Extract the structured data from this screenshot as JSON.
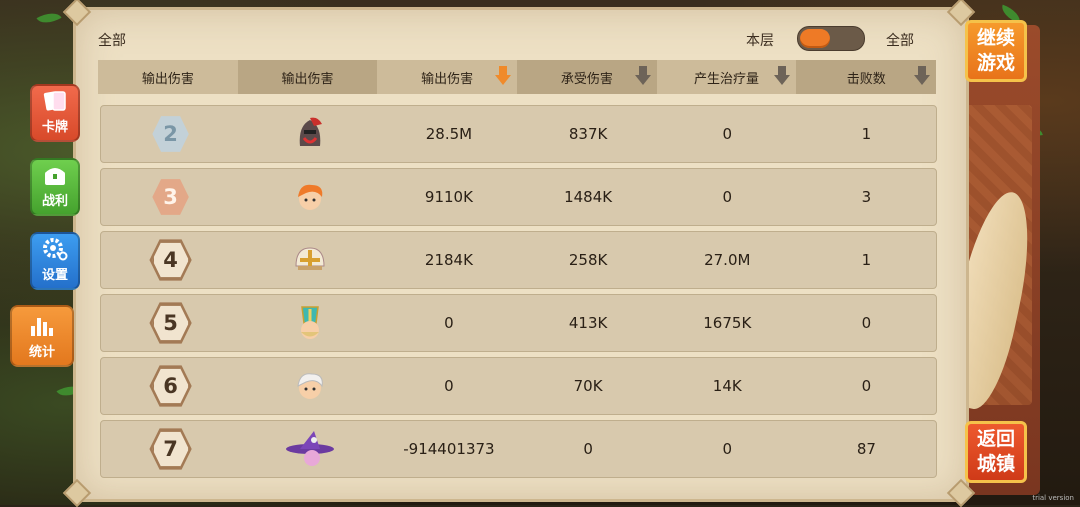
{
  "top": {
    "left_label": "全部",
    "floor_label": "本层",
    "all_label": "全部"
  },
  "header": [
    "输出伤害",
    "输出伤害",
    "输出伤害",
    "承受伤害",
    "产生治疗量",
    "击败数"
  ],
  "rows": [
    {
      "rank": "2",
      "style": "silver",
      "avatar": "red-helmet-knight-icon",
      "dmg": "28.5M",
      "taken": "837K",
      "heal": "0",
      "kills": "1"
    },
    {
      "rank": "3",
      "style": "bronze",
      "avatar": "orange-hair-hero-icon",
      "dmg": "9110K",
      "taken": "1484K",
      "heal": "0",
      "kills": "3"
    },
    {
      "rank": "4",
      "style": "plain",
      "avatar": "paladin-helmet-icon",
      "dmg": "2184K",
      "taken": "258K",
      "heal": "27.0M",
      "kills": "1"
    },
    {
      "rank": "5",
      "style": "plain",
      "avatar": "bishop-priest-icon",
      "dmg": "0",
      "taken": "413K",
      "heal": "1675K",
      "kills": "0"
    },
    {
      "rank": "6",
      "style": "plain",
      "avatar": "white-hair-hero-icon",
      "dmg": "0",
      "taken": "70K",
      "heal": "14K",
      "kills": "0"
    },
    {
      "rank": "7",
      "style": "plain",
      "avatar": "purple-witch-icon",
      "dmg": "-914401373",
      "taken": "0",
      "heal": "0",
      "kills": "87"
    }
  ],
  "side": {
    "cards": "卡牌",
    "loot": "战利",
    "settings": "设置",
    "stats": "统计"
  },
  "right": {
    "continue_line1": "继续",
    "continue_line2": "游戏",
    "return_line1": "返回",
    "return_line2": "城镇"
  },
  "watermark": "trial version",
  "colors": {
    "accent": "#f08a2a",
    "parchment": "#ede0c4",
    "row": "#d8c9ad"
  }
}
